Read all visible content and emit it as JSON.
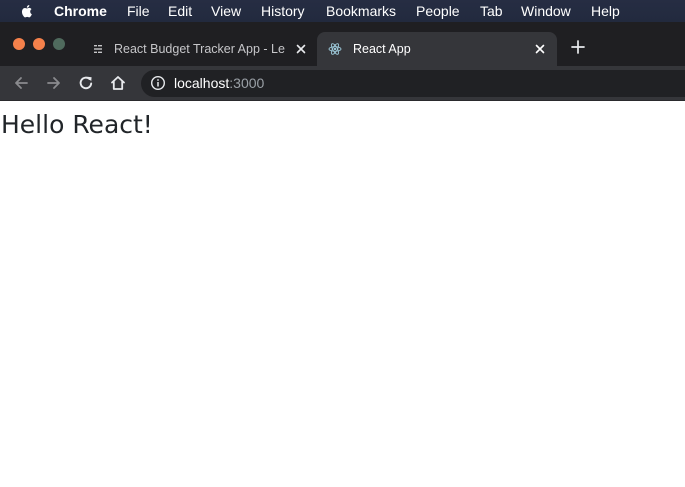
{
  "menubar": {
    "app_name": "Chrome",
    "items": [
      "File",
      "Edit",
      "View",
      "History",
      "Bookmarks",
      "People",
      "Tab",
      "Window",
      "Help"
    ]
  },
  "tabs": [
    {
      "title": "React Budget Tracker App - Le",
      "active": false,
      "icon": "document-lines-icon"
    },
    {
      "title": "React App",
      "active": true,
      "icon": "react-logo-icon"
    }
  ],
  "address_bar": {
    "host": "localhost",
    "port": ":3000"
  },
  "page": {
    "heading": "Hello React!"
  },
  "colors": {
    "menubar_bg": "#232b40",
    "tabstrip_bg": "#1f1f22",
    "active_tab_bg": "#35363a",
    "traffic_close": "#f5814b",
    "traffic_min": "#f5814b",
    "traffic_zoom": "#4f6a5d",
    "text_dark": "#212529"
  }
}
